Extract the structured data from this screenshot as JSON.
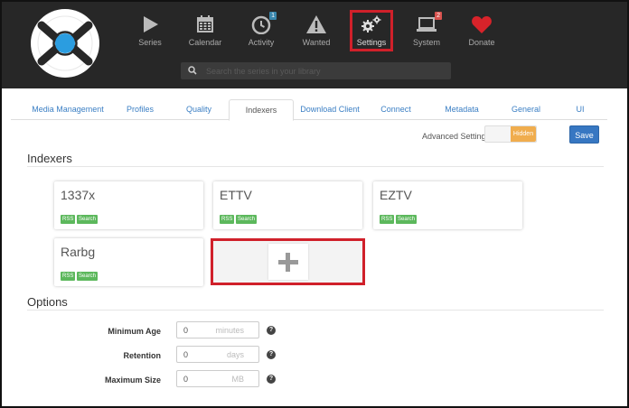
{
  "nav": {
    "items": [
      {
        "label": "Series"
      },
      {
        "label": "Calendar"
      },
      {
        "label": "Activity",
        "badge": "1"
      },
      {
        "label": "Wanted"
      },
      {
        "label": "Settings"
      },
      {
        "label": "System",
        "badge": "2"
      },
      {
        "label": "Donate"
      }
    ]
  },
  "search": {
    "placeholder": "Search the series in your library"
  },
  "tabs": [
    "Media Management",
    "Profiles",
    "Quality",
    "Indexers",
    "Download Client",
    "Connect",
    "Metadata",
    "General",
    "UI"
  ],
  "settings": {
    "advanced_label": "Advanced Settings",
    "advanced_state": "Hidden",
    "save_label": "Save"
  },
  "indexers": {
    "title": "Indexers",
    "cards": [
      {
        "name": "1337x",
        "tags": [
          "RSS",
          "Search"
        ]
      },
      {
        "name": "ETTV",
        "tags": [
          "RSS",
          "Search"
        ]
      },
      {
        "name": "EZTV",
        "tags": [
          "RSS",
          "Search"
        ]
      },
      {
        "name": "Rarbg",
        "tags": [
          "RSS",
          "Search"
        ]
      }
    ]
  },
  "options": {
    "title": "Options",
    "fields": [
      {
        "label": "Minimum Age",
        "value": "0",
        "unit": "minutes"
      },
      {
        "label": "Retention",
        "value": "0",
        "unit": "days"
      },
      {
        "label": "Maximum Size",
        "value": "0",
        "unit": "MB"
      }
    ]
  },
  "colors": {
    "accent": "#3777c2",
    "highlight": "#d0202a",
    "tag": "#5cb85c",
    "badge_blue": "#3a87ad",
    "badge_red": "#d9534f",
    "donate": "#d8232a"
  }
}
